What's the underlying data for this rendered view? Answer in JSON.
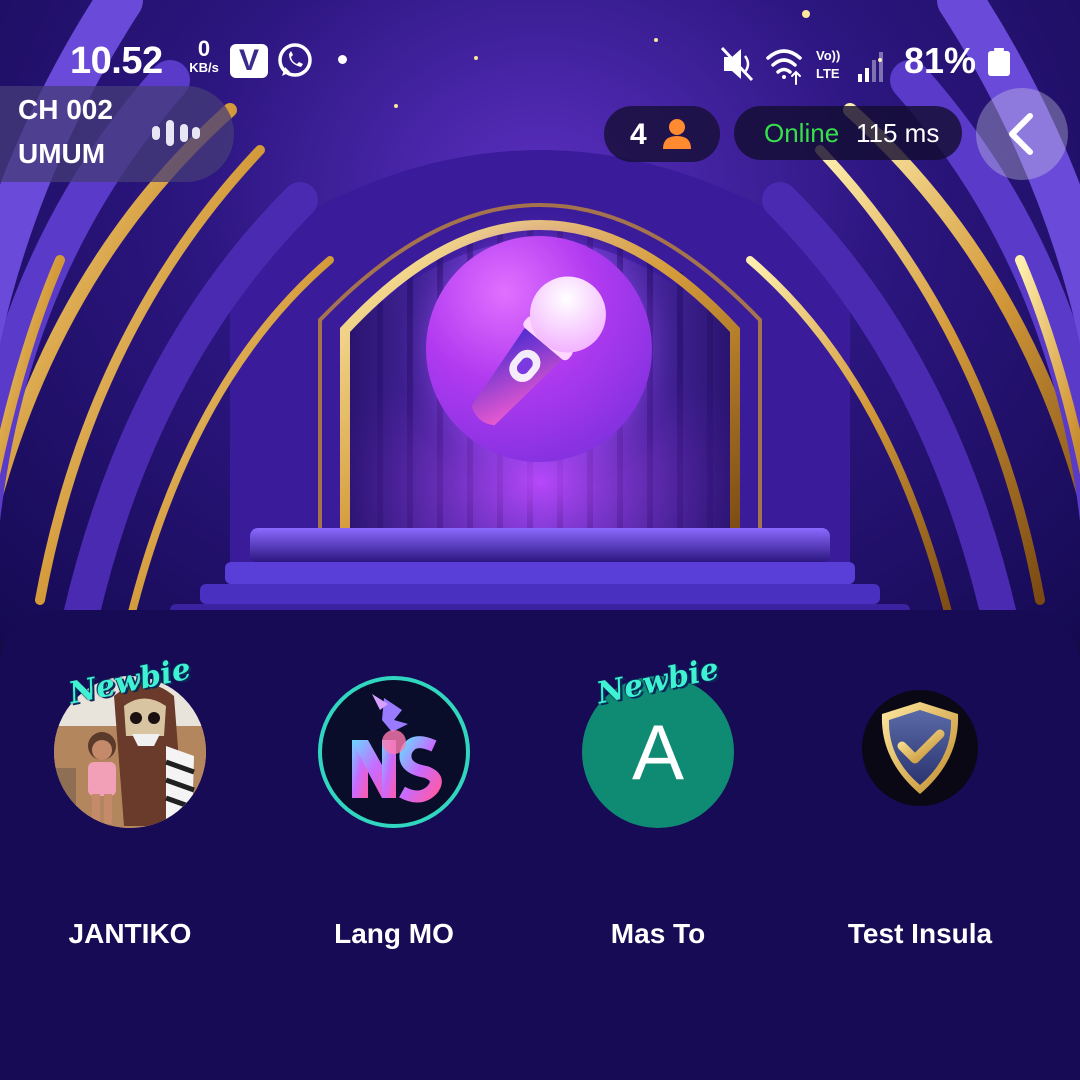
{
  "status_bar": {
    "time": "10.52",
    "net_speed_value": "0",
    "net_speed_unit": "KB/s",
    "app_badge_letter": "V",
    "battery_percent": "81%",
    "icons": [
      "vivo-icon",
      "whatsapp-icon",
      "mute-icon",
      "wifi-icon",
      "volte-icon",
      "signal-icon",
      "battery-icon"
    ]
  },
  "channel": {
    "code": "CH 002",
    "name": "UMUM"
  },
  "room": {
    "user_count": "4",
    "status_label": "Online",
    "ping": "115 ms"
  },
  "seats": [
    {
      "name": "JANTIKO",
      "badge": "Newbie",
      "avatar_type": "photo"
    },
    {
      "name": "Lang MO",
      "badge": "",
      "avatar_type": "logo"
    },
    {
      "name": "Mas To",
      "badge": "Newbie",
      "avatar_type": "letter",
      "avatar_letter": "A"
    },
    {
      "name": "Test Insula",
      "badge": "",
      "avatar_type": "shield"
    }
  ],
  "colors": {
    "online": "#35e04a",
    "panel": "#170b55",
    "badge": "#3ff2d2",
    "mic_gradient": "#b13af0"
  }
}
